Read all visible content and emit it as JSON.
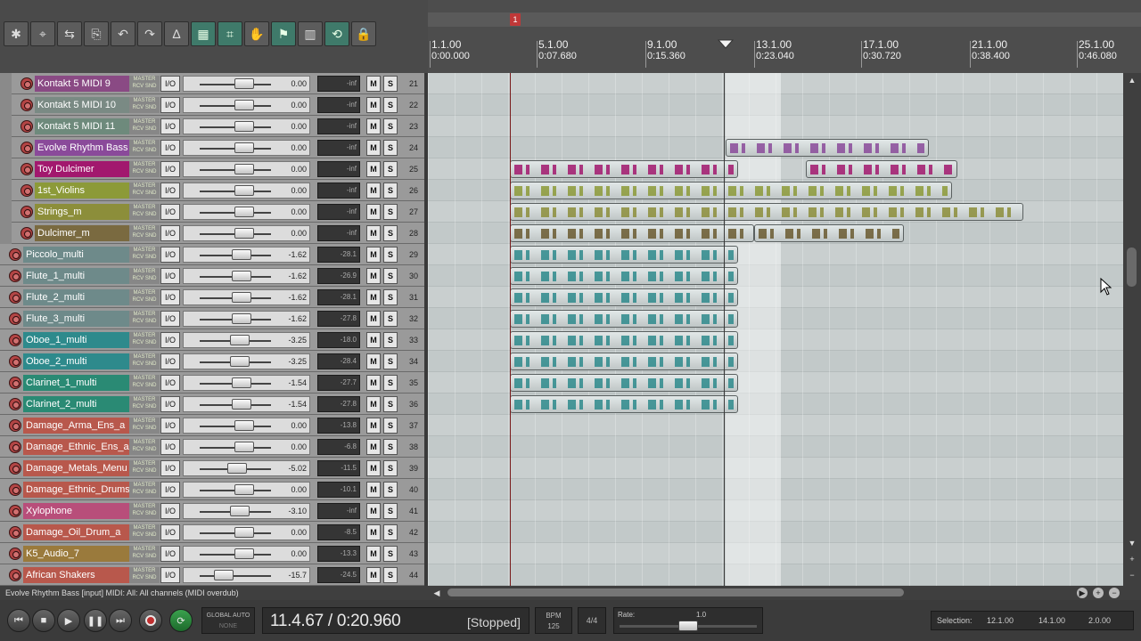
{
  "toolbar": {
    "buttons": [
      {
        "name": "new-project",
        "glyph": "✱",
        "active": false
      },
      {
        "name": "snap-item",
        "glyph": "⌖",
        "active": false
      },
      {
        "name": "ripple",
        "glyph": "⇆",
        "active": false
      },
      {
        "name": "lock-items",
        "glyph": "⎘",
        "active": false
      },
      {
        "name": "undo",
        "glyph": "↶",
        "active": false
      },
      {
        "name": "redo",
        "glyph": "↷",
        "active": false
      },
      {
        "name": "envelope",
        "glyph": "∆",
        "active": false
      },
      {
        "name": "item-grouping",
        "glyph": "▦",
        "active": true
      },
      {
        "name": "snap-grid",
        "glyph": "⌗",
        "active": true
      },
      {
        "name": "edit-mode",
        "glyph": "✋",
        "active": false
      },
      {
        "name": "markers",
        "glyph": "⚑",
        "active": true
      },
      {
        "name": "grid-lines",
        "glyph": "▥",
        "active": false
      },
      {
        "name": "loop-record",
        "glyph": "⟲",
        "active": true
      },
      {
        "name": "lock",
        "glyph": "🔒",
        "active": false
      }
    ]
  },
  "ruler": {
    "marker_label": "1",
    "labels": [
      {
        "bar": "1.1.00",
        "time": "0:00.000"
      },
      {
        "bar": "5.1.00",
        "time": "0:07.680"
      },
      {
        "bar": "9.1.00",
        "time": "0:15.360"
      },
      {
        "bar": "13.1.00",
        "time": "0:23.040"
      },
      {
        "bar": "17.1.00",
        "time": "0:30.720"
      },
      {
        "bar": "21.1.00",
        "time": "0:38.400"
      },
      {
        "bar": "25.1.00",
        "time": "0:46.080"
      }
    ]
  },
  "tracks": [
    {
      "num": "21",
      "name": "Kontakt 5 MIDI 9",
      "color": "#8a4a84",
      "vol": "0.00",
      "peak": "-inf",
      "indent": 1
    },
    {
      "num": "22",
      "name": "Kontakt 5 MIDI 10",
      "color": "#7a8a84",
      "vol": "0.00",
      "peak": "-inf",
      "indent": 1
    },
    {
      "num": "23",
      "name": "Kontakt 5 MIDI 11",
      "color": "#6e8a7c",
      "vol": "0.00",
      "peak": "-inf",
      "indent": 1
    },
    {
      "num": "24",
      "name": "Evolve Rhythm Bass",
      "color": "#8a4a9a",
      "vol": "0.00",
      "peak": "-inf",
      "indent": 1
    },
    {
      "num": "25",
      "name": "Toy Dulcimer",
      "color": "#a2186e",
      "vol": "0.00",
      "peak": "-inf",
      "indent": 1
    },
    {
      "num": "26",
      "name": "1st_Violins",
      "color": "#8c9a38",
      "vol": "0.00",
      "peak": "-inf",
      "indent": 1
    },
    {
      "num": "27",
      "name": "Strings_m",
      "color": "#8c8e3a",
      "vol": "0.00",
      "peak": "-inf",
      "indent": 1
    },
    {
      "num": "28",
      "name": "Dulcimer_m",
      "color": "#7a6a40",
      "vol": "0.00",
      "peak": "-inf",
      "indent": 1
    },
    {
      "num": "29",
      "name": "Piccolo_multi",
      "color": "#6e8a8a",
      "vol": "-1.62",
      "peak": "-28.1",
      "indent": 0
    },
    {
      "num": "30",
      "name": "Flute_1_multi",
      "color": "#6e8a8a",
      "vol": "-1.62",
      "peak": "-26.9",
      "indent": 0
    },
    {
      "num": "31",
      "name": "Flute_2_multi",
      "color": "#6e8a8a",
      "vol": "-1.62",
      "peak": "-28.1",
      "indent": 0
    },
    {
      "num": "32",
      "name": "Flute_3_multi",
      "color": "#6e8a8a",
      "vol": "-1.62",
      "peak": "-27.8",
      "indent": 0
    },
    {
      "num": "33",
      "name": "Oboe_1_multi",
      "color": "#2e8a8c",
      "vol": "-3.25",
      "peak": "-18.0",
      "indent": 0
    },
    {
      "num": "34",
      "name": "Oboe_2_multi",
      "color": "#2e8a8c",
      "vol": "-3.25",
      "peak": "-28.4",
      "indent": 0
    },
    {
      "num": "35",
      "name": "Clarinet_1_multi",
      "color": "#2a8a74",
      "vol": "-1.54",
      "peak": "-27.7",
      "indent": 0
    },
    {
      "num": "36",
      "name": "Clarinet_2_multi",
      "color": "#2a8a74",
      "vol": "-1.54",
      "peak": "-27.8",
      "indent": 0
    },
    {
      "num": "37",
      "name": "Damage_Arma_Ens_a",
      "color": "#b8584c",
      "vol": "0.00",
      "peak": "-13.8",
      "indent": 0
    },
    {
      "num": "38",
      "name": "Damage_Ethnic_Ens_a",
      "color": "#b8584c",
      "vol": "0.00",
      "peak": "-6.8",
      "indent": 0
    },
    {
      "num": "39",
      "name": "Damage_Metals_Menu",
      "color": "#b8584c",
      "vol": "-5.02",
      "peak": "-11.5",
      "indent": 0
    },
    {
      "num": "40",
      "name": "Damage_Ethnic_Drums",
      "color": "#b8584c",
      "vol": "0.00",
      "peak": "-10.1",
      "indent": 0
    },
    {
      "num": "41",
      "name": "Xylophone",
      "color": "#b84e7a",
      "vol": "-3.10",
      "peak": "-inf",
      "indent": 0
    },
    {
      "num": "42",
      "name": "Damage_Oil_Drum_a",
      "color": "#b8584c",
      "vol": "0.00",
      "peak": "-8.5",
      "indent": 0
    },
    {
      "num": "43",
      "name": "K5_Audio_7",
      "color": "#9a7a3c",
      "vol": "0.00",
      "peak": "-13.3",
      "indent": 0
    },
    {
      "num": "44",
      "name": "African Shakers",
      "color": "#b8584c",
      "vol": "-15.7",
      "peak": "-24.5",
      "indent": 0
    }
  ],
  "track_labels": {
    "master": "MASTER",
    "rcv": "RCV SND",
    "io": "I/O",
    "mute": "M",
    "solo": "S"
  },
  "items": [
    {
      "lane": 3,
      "start": 334,
      "end": 562,
      "color": "#8a4a9a"
    },
    {
      "lane": 4,
      "start": 92,
      "end": 348,
      "color": "#a2186e"
    },
    {
      "lane": 4,
      "start": 424,
      "end": 594,
      "color": "#a2186e"
    },
    {
      "lane": 5,
      "start": 92,
      "end": 588,
      "color": "#8c9a38"
    },
    {
      "lane": 6,
      "start": 92,
      "end": 668,
      "color": "#8c8e3a"
    },
    {
      "lane": 7,
      "start": 92,
      "end": 366,
      "color": "#6a5a30"
    },
    {
      "lane": 7,
      "start": 366,
      "end": 534,
      "color": "#6a5a30"
    },
    {
      "lane": 8,
      "start": 92,
      "end": 348,
      "color": "#2e8a8c"
    },
    {
      "lane": 9,
      "start": 92,
      "end": 348,
      "color": "#2e8a8c"
    },
    {
      "lane": 10,
      "start": 92,
      "end": 348,
      "color": "#2e8a8c"
    },
    {
      "lane": 11,
      "start": 92,
      "end": 348,
      "color": "#2e8a8c"
    },
    {
      "lane": 12,
      "start": 92,
      "end": 348,
      "color": "#2e8a8c"
    },
    {
      "lane": 13,
      "start": 92,
      "end": 348,
      "color": "#2e8a8c"
    },
    {
      "lane": 14,
      "start": 92,
      "end": 348,
      "color": "#2e8a8c"
    },
    {
      "lane": 15,
      "start": 92,
      "end": 348,
      "color": "#2e8a8c"
    }
  ],
  "status": {
    "text": "Evolve Rhythm Bass [input] MIDI: All: All channels (MIDI overdub)"
  },
  "transport": {
    "global_auto": "GLOBAL AUTO",
    "global_auto_mode": "NONE",
    "position": "11.4.67 / 0:20.960",
    "state": "[Stopped]",
    "bpm_label": "BPM",
    "bpm": "125",
    "time_sig": "4/4",
    "rate_label": "Rate:",
    "rate": "1.0",
    "rate_level": 0.5,
    "selection_label": "Selection:",
    "sel_start": "12.1.00",
    "sel_end": "14.1.00",
    "sel_length": "2.0.00"
  }
}
